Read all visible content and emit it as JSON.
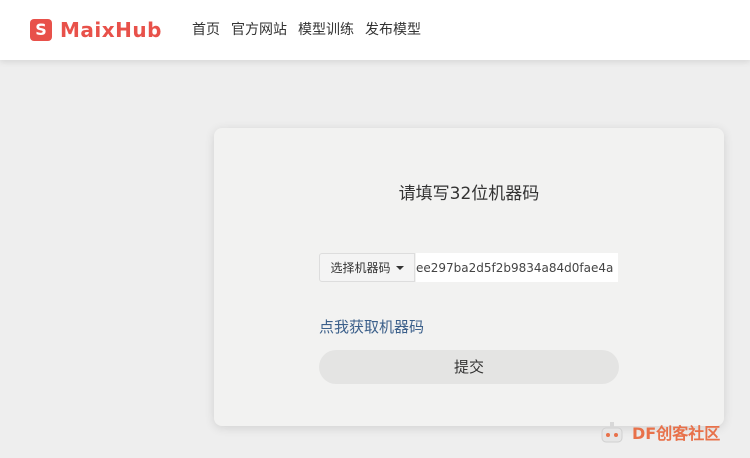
{
  "brand": {
    "logo_letter": "S",
    "name": "MaixHub",
    "accent": "#e8514a"
  },
  "nav": {
    "items": [
      {
        "label": "首页"
      },
      {
        "label": "官方网站"
      },
      {
        "label": "模型训练"
      },
      {
        "label": "发布模型"
      }
    ]
  },
  "form": {
    "title": "请填写32位机器码",
    "select_label": "选择机器码",
    "machine_code_value": "ee297ba2d5f2b9834a84d0fae4a",
    "get_code_link": "点我获取机器码",
    "submit_label": "提交"
  },
  "watermark": {
    "text": "DF创客社区",
    "icon": "robot-icon"
  }
}
